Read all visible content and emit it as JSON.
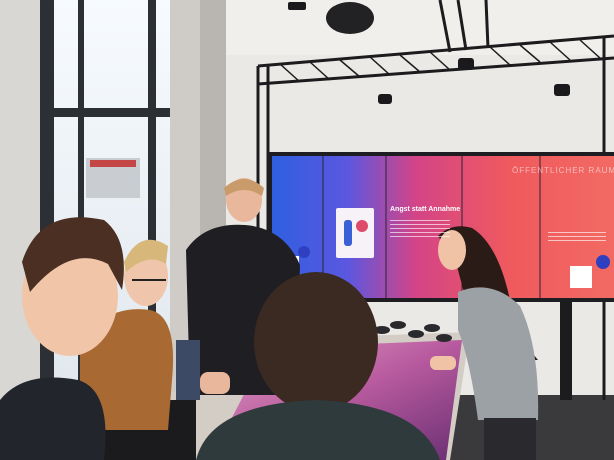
{
  "photo": {
    "scene": "Exhibition room with a large interactive video wall and touch table",
    "wall_heading": "Angst statt Annahme",
    "wall_heading_right": "ÖFFENTLICHER RAUM",
    "colors": {
      "wall_blue": "#3a6fe8",
      "wall_magenta": "#e0457a",
      "wall_red": "#f0565a",
      "truss": "#1c1c1f",
      "ceiling": "#f1efec",
      "floor": "#3a3a3c"
    }
  }
}
